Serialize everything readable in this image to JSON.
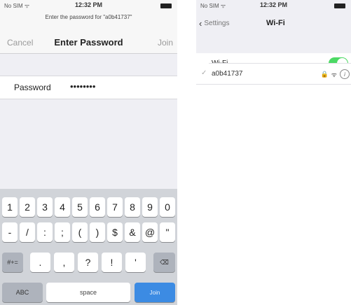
{
  "left": {
    "status": {
      "carrier": "No SIM ᯤ",
      "time": "12:32 PM"
    },
    "prompt": "Enter the password for \"a0b41737\"",
    "nav": {
      "cancel": "Cancel",
      "title": "Enter Password",
      "join": "Join"
    },
    "password": {
      "label": "Password",
      "value": "••••••••"
    }
  },
  "keyboard": {
    "row1": [
      "1",
      "2",
      "3",
      "4",
      "5",
      "6",
      "7",
      "8",
      "9",
      "0"
    ],
    "row2": [
      "-",
      "/",
      ":",
      ";",
      "(",
      ")",
      "$",
      "&",
      "@",
      "\""
    ],
    "row3": [
      "#+=",
      ".",
      ",",
      "?",
      "!",
      "'",
      "⌫"
    ],
    "row4": [
      "ABC",
      "space",
      "Join"
    ]
  },
  "right": {
    "status": {
      "carrier": "No SIM ᯤ",
      "time": "12:32 PM"
    },
    "nav": {
      "back": "Settings",
      "title": "Wi-Fi"
    },
    "wifi_label": "Wi-Fi",
    "wifi_on": true,
    "network": {
      "name": "a0b41737",
      "lock": "🔒",
      "signal": "ᯤ",
      "info": "i"
    }
  }
}
